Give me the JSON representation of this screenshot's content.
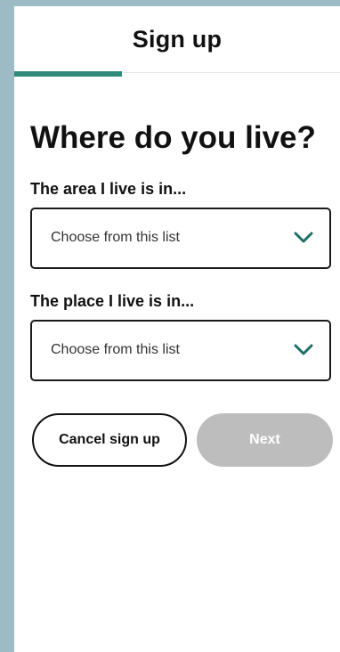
{
  "header": {
    "title": "Sign up",
    "progress_fraction": 0.33
  },
  "page": {
    "title": "Where do you live?"
  },
  "area_field": {
    "label": "The area I live is in...",
    "value": "Choose from this list"
  },
  "place_field": {
    "label": "The place I live is in...",
    "value": "Choose from this list"
  },
  "actions": {
    "cancel_label": "Cancel sign up",
    "next_label": "Next"
  },
  "colors": {
    "progress": "#2e8b7a",
    "next_disabled": "#bdbdbd",
    "side_background": "#9dbbc4"
  },
  "icons": {
    "select_chevron": "chevron-down-icon"
  }
}
